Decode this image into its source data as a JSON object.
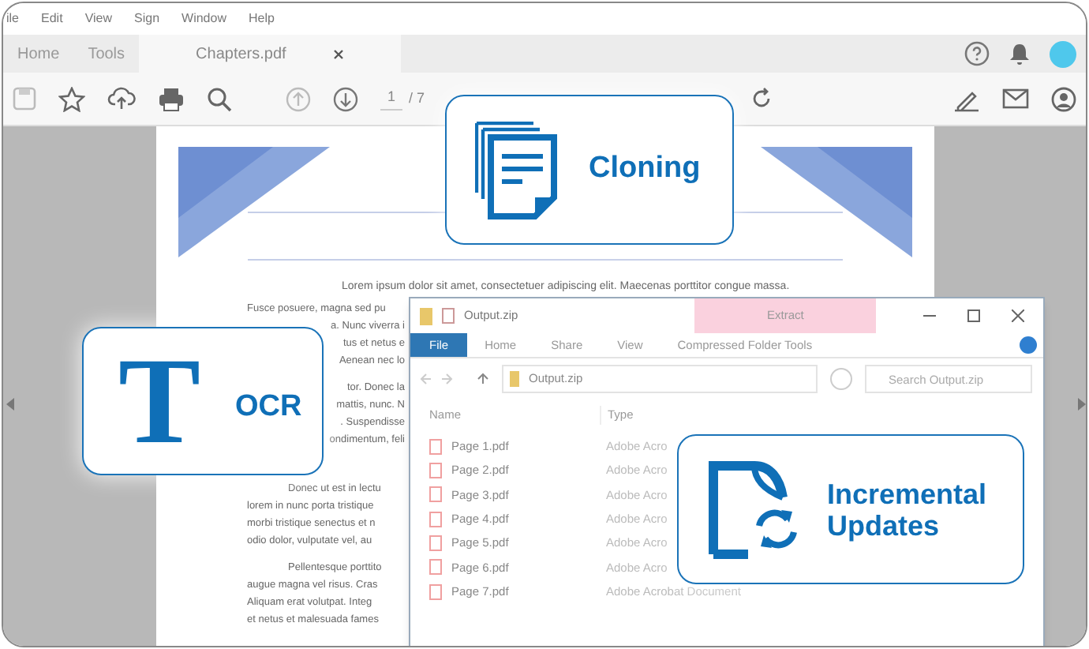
{
  "menu_bar": [
    "ile",
    "Edit",
    "View",
    "Sign",
    "Window",
    "Help"
  ],
  "tabs": [
    {
      "label": "Home",
      "selected": false
    },
    {
      "label": "Tools",
      "selected": false
    },
    {
      "label": "Chapters.pdf",
      "selected": true,
      "closable": true
    }
  ],
  "toolbar": {
    "page_number": "1",
    "page_total": "/ 7"
  },
  "document": {
    "opening_line": "Lorem ipsum dolor sit amet, consectetuer adipiscing elit. Maecenas porttitor congue massa.",
    "paragraphs": [
      {
        "lines": [
          {
            "kind": "head",
            "text": "Fusce posuere, magna sed pu"
          },
          {
            "kind": "tail",
            "text": "a. Nunc viverra i"
          },
          {
            "kind": "tail",
            "text": "tus et netus e"
          },
          {
            "kind": "tail",
            "text": "Aenean nec lo"
          }
        ]
      },
      {
        "lines": [
          {
            "kind": "tail",
            "text": "tor. Donec la"
          },
          {
            "kind": "tail",
            "text": "mattis, nunc. N"
          },
          {
            "kind": "tail",
            "text": ". Suspendisse"
          },
          {
            "kind": "tail",
            "text": "ondimentum, feli"
          }
        ]
      },
      {
        "lines": [
          {
            "kind": "indent",
            "text": "Donec ut est in lectu"
          },
          {
            "kind": "head",
            "text": "lorem in nunc porta tristique"
          },
          {
            "kind": "head",
            "text": "morbi tristique senectus et n"
          },
          {
            "kind": "head",
            "text": "odio dolor, vulputate vel, au"
          }
        ]
      },
      {
        "lines": [
          {
            "kind": "indent",
            "text": "Pellentesque porttito"
          },
          {
            "kind": "head",
            "text": "augue magna vel risus. Cras"
          },
          {
            "kind": "head",
            "text": "Aliquam erat volutpat. Integ"
          },
          {
            "kind": "head",
            "text": "et netus et malesuada fames"
          }
        ]
      }
    ]
  },
  "explorer": {
    "title": "Output.zip",
    "context_tab": "Extract",
    "ribbon_tabs": [
      {
        "label": "File",
        "selected": true
      },
      {
        "label": "Home",
        "selected": false
      },
      {
        "label": "Share",
        "selected": false
      },
      {
        "label": "View",
        "selected": false
      },
      {
        "label": "Compressed Folder Tools",
        "selected": false
      }
    ],
    "address": "Output.zip",
    "search": {
      "placeholder": "Search Output.zip"
    },
    "columns": [
      "Name",
      "Type"
    ],
    "files": [
      {
        "name": "Page 1.pdf",
        "type": "Adobe Acro"
      },
      {
        "name": "Page 2.pdf",
        "type": "Adobe Acro"
      },
      {
        "name": "Page 3.pdf",
        "type": "Adobe Acro"
      },
      {
        "name": "Page 4.pdf",
        "type": "Adobe Acro"
      },
      {
        "name": "Page 5.pdf",
        "type": "Adobe Acro"
      },
      {
        "name": "Page 6.pdf",
        "type": "Adobe Acro"
      },
      {
        "name": "Page 7.pdf",
        "type": "Adobe Acrobat Document"
      }
    ]
  },
  "feature_cards": [
    {
      "kind": "cloning",
      "label": "Cloning"
    },
    {
      "kind": "ocr",
      "glyph": "T",
      "label": "OCR"
    },
    {
      "kind": "updates",
      "label": "Incremental Updates"
    }
  ]
}
